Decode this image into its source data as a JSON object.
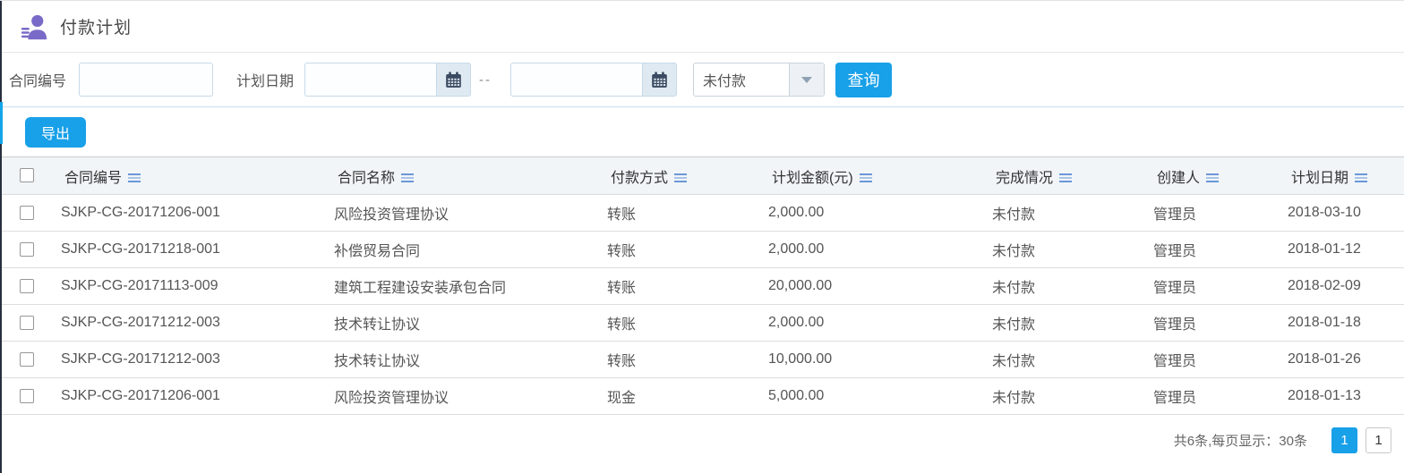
{
  "header": {
    "title": "付款计划"
  },
  "filter": {
    "contract_no_label": "合同编号",
    "contract_no_value": "",
    "plan_date_label": "计划日期",
    "date_from_value": "",
    "date_to_value": "",
    "range_separator": "--",
    "status_selected": "未付款",
    "search_label": "查询"
  },
  "toolbar": {
    "export_label": "导出"
  },
  "table": {
    "columns": [
      "合同编号",
      "合同名称",
      "付款方式",
      "计划金额(元)",
      "完成情况",
      "创建人",
      "计划日期"
    ],
    "rows": [
      {
        "no": "SJKP-CG-20171206-001",
        "name": "风险投资管理协议",
        "method": "转账",
        "amount": "2,000.00",
        "status": "未付款",
        "creator": "管理员",
        "date": "2018-03-10"
      },
      {
        "no": "SJKP-CG-20171218-001",
        "name": "补偿贸易合同",
        "method": "转账",
        "amount": "2,000.00",
        "status": "未付款",
        "creator": "管理员",
        "date": "2018-01-12"
      },
      {
        "no": "SJKP-CG-20171113-009",
        "name": "建筑工程建设安装承包合同",
        "method": "转账",
        "amount": "20,000.00",
        "status": "未付款",
        "creator": "管理员",
        "date": "2018-02-09"
      },
      {
        "no": "SJKP-CG-20171212-003",
        "name": "技术转让协议",
        "method": "转账",
        "amount": "2,000.00",
        "status": "未付款",
        "creator": "管理员",
        "date": "2018-01-18"
      },
      {
        "no": "SJKP-CG-20171212-003",
        "name": "技术转让协议",
        "method": "转账",
        "amount": "10,000.00",
        "status": "未付款",
        "creator": "管理员",
        "date": "2018-01-26"
      },
      {
        "no": "SJKP-CG-20171206-001",
        "name": "风险投资管理协议",
        "method": "现金",
        "amount": "5,000.00",
        "status": "未付款",
        "creator": "管理员",
        "date": "2018-01-13"
      }
    ]
  },
  "footer": {
    "summary": "共6条,每页显示：30条",
    "active_page": "1",
    "page_box": "1"
  },
  "colors": {
    "accent": "#18a0e8",
    "sort_icon": "#6b97d8",
    "title_icon": "#7a6ac8",
    "calendar_icon": "#3a4a61"
  }
}
